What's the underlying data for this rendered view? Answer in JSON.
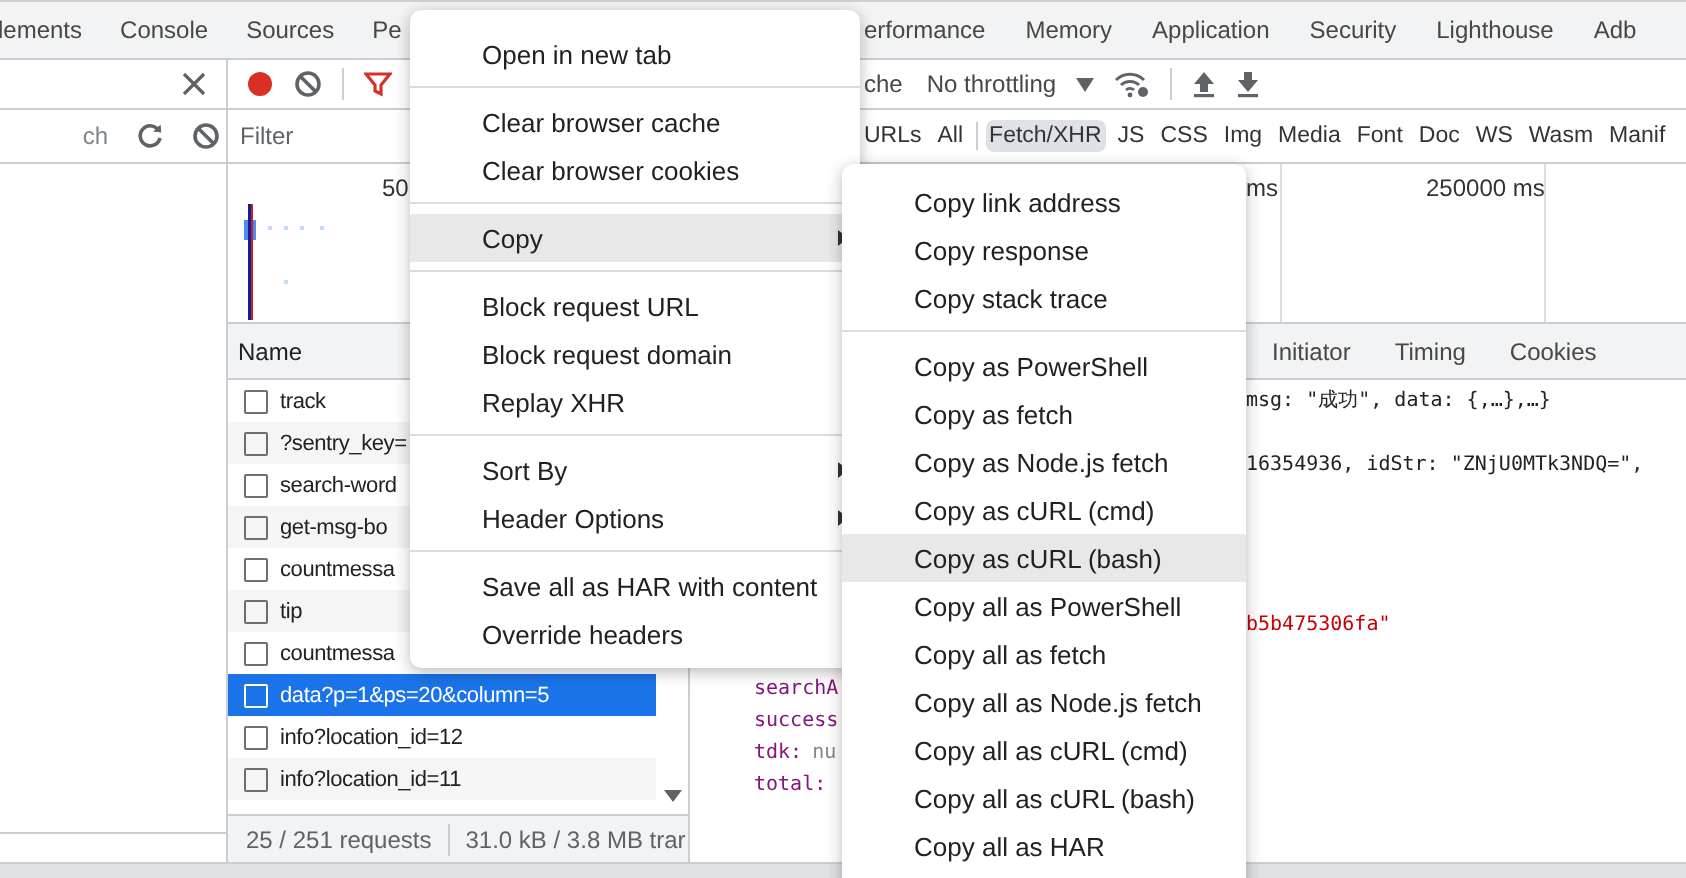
{
  "panel_tabs_left": [
    {
      "label": "lements"
    },
    {
      "label": "Console"
    },
    {
      "label": "Sources"
    },
    {
      "label": "Pe"
    }
  ],
  "panel_tabs_right": [
    {
      "label": "erformance"
    },
    {
      "label": "Memory"
    },
    {
      "label": "Application"
    },
    {
      "label": "Security"
    },
    {
      "label": "Lighthouse"
    },
    {
      "label": "Adb"
    }
  ],
  "left_panel": {
    "search_placeholder": "ch"
  },
  "toolbar": {
    "recording": true,
    "cache_text": "che",
    "throttling": "No throttling"
  },
  "filter": {
    "placeholder": "Filter",
    "types": [
      {
        "label": "URLs",
        "selected": false
      },
      {
        "label": "All",
        "selected": false,
        "divider_after": true
      },
      {
        "label": "Fetch/XHR",
        "selected": true
      },
      {
        "label": "JS",
        "selected": false
      },
      {
        "label": "CSS",
        "selected": false
      },
      {
        "label": "Img",
        "selected": false
      },
      {
        "label": "Media",
        "selected": false
      },
      {
        "label": "Font",
        "selected": false
      },
      {
        "label": "Doc",
        "selected": false
      },
      {
        "label": "WS",
        "selected": false
      },
      {
        "label": "Wasm",
        "selected": false
      },
      {
        "label": "Manif",
        "selected": false
      }
    ]
  },
  "overview": {
    "ticks": [
      "50",
      "ms",
      "250000 ms"
    ]
  },
  "request_list": {
    "column": "Name",
    "rows": [
      {
        "name": "track",
        "selected": false
      },
      {
        "name": "?sentry_key=",
        "selected": false
      },
      {
        "name": "search-word",
        "selected": false
      },
      {
        "name": "get-msg-bo",
        "selected": false
      },
      {
        "name": "countmessa",
        "selected": false
      },
      {
        "name": "tip",
        "selected": false
      },
      {
        "name": "countmessa",
        "selected": false
      },
      {
        "name": "data?p=1&ps=20&column=5",
        "selected": true
      },
      {
        "name": "info?location_id=12",
        "selected": false
      },
      {
        "name": "info?location_id=11",
        "selected": false
      }
    ],
    "requests": "25 / 251 requests",
    "transferred": "31.0 kB / 3.8 MB trar"
  },
  "detail": {
    "tabs": [
      {
        "label": "Initiator"
      },
      {
        "label": "Timing"
      },
      {
        "label": "Cookies"
      }
    ],
    "preview_lines": [
      {
        "kind": "text",
        "text": "msg: \"成功\", data: {,…},…}"
      },
      {
        "kind": "text",
        "text": "16354936, idStr: \"ZNjU0MTk3NDQ=\","
      },
      {
        "kind": "string",
        "text": "b5b475306fa\""
      },
      {
        "kind": "field",
        "key": "searchA"
      },
      {
        "kind": "field",
        "key": "success"
      },
      {
        "kind": "field",
        "key": "tdk:",
        "value": "nu"
      },
      {
        "kind": "field",
        "key": "total:"
      }
    ]
  },
  "context_menu": {
    "items": [
      {
        "kind": "item",
        "label": "Open in new tab",
        "selected": false,
        "has_submenu": false
      },
      {
        "kind": "separator"
      },
      {
        "kind": "item",
        "label": "Clear browser cache",
        "selected": false,
        "has_submenu": false
      },
      {
        "kind": "item",
        "label": "Clear browser cookies",
        "selected": false,
        "has_submenu": false
      },
      {
        "kind": "separator"
      },
      {
        "kind": "item",
        "label": "Copy",
        "selected": true,
        "has_submenu": true
      },
      {
        "kind": "separator"
      },
      {
        "kind": "item",
        "label": "Block request URL",
        "selected": false,
        "has_submenu": false
      },
      {
        "kind": "item",
        "label": "Block request domain",
        "selected": false,
        "has_submenu": false
      },
      {
        "kind": "item",
        "label": "Replay XHR",
        "selected": false,
        "has_submenu": false
      },
      {
        "kind": "separator"
      },
      {
        "kind": "item",
        "label": "Sort By",
        "selected": false,
        "has_submenu": true
      },
      {
        "kind": "item",
        "label": "Header Options",
        "selected": false,
        "has_submenu": true
      },
      {
        "kind": "separator"
      },
      {
        "kind": "item",
        "label": "Save all as HAR with content",
        "selected": false,
        "has_submenu": false
      },
      {
        "kind": "item",
        "label": "Override headers",
        "selected": false,
        "has_submenu": false
      }
    ]
  },
  "copy_submenu": {
    "items": [
      {
        "kind": "item",
        "label": "Copy link address",
        "selected": false
      },
      {
        "kind": "item",
        "label": "Copy response",
        "selected": false
      },
      {
        "kind": "item",
        "label": "Copy stack trace",
        "selected": false
      },
      {
        "kind": "separator"
      },
      {
        "kind": "item",
        "label": "Copy as PowerShell",
        "selected": false
      },
      {
        "kind": "item",
        "label": "Copy as fetch",
        "selected": false
      },
      {
        "kind": "item",
        "label": "Copy as Node.js fetch",
        "selected": false
      },
      {
        "kind": "item",
        "label": "Copy as cURL (cmd)",
        "selected": false
      },
      {
        "kind": "item",
        "label": "Copy as cURL (bash)",
        "selected": true
      },
      {
        "kind": "item",
        "label": "Copy all as PowerShell",
        "selected": false
      },
      {
        "kind": "item",
        "label": "Copy all as fetch",
        "selected": false
      },
      {
        "kind": "item",
        "label": "Copy all as Node.js fetch",
        "selected": false
      },
      {
        "kind": "item",
        "label": "Copy all as cURL (cmd)",
        "selected": false
      },
      {
        "kind": "item",
        "label": "Copy all as cURL (bash)",
        "selected": false
      },
      {
        "kind": "item",
        "label": "Copy all as HAR",
        "selected": false
      }
    ]
  }
}
